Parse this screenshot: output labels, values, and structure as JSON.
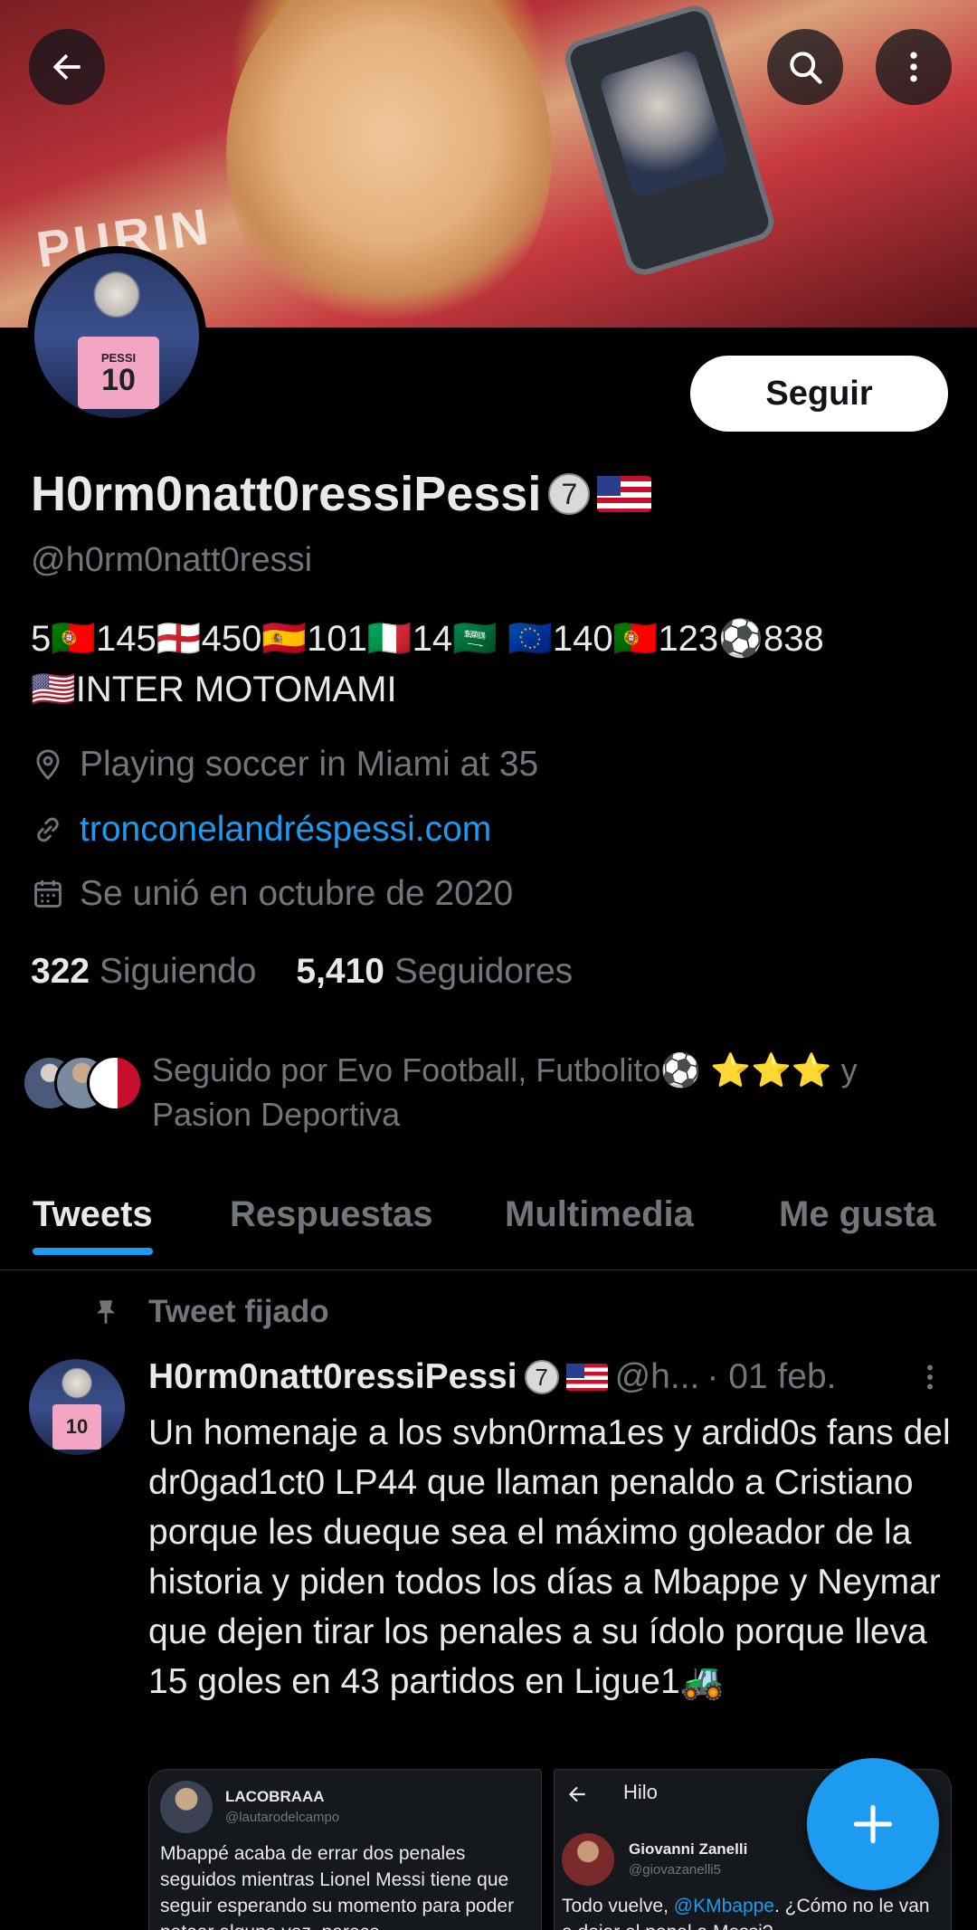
{
  "header": {
    "back_icon": "arrow-left-icon",
    "search_icon": "search-icon",
    "more_icon": "more-vertical-icon",
    "banner_text": "PURIN"
  },
  "profile": {
    "follow_label": "Seguir",
    "display_name": "H0rm0natt0ressiPessi",
    "badge": "7",
    "handle": "@h0rm0natt0ressi",
    "bio_line1": "5🇵🇹145🏴󠁧󠁢󠁥󠁮󠁧󠁿450🇪🇸101🇮🇹14🇸🇦 🇪🇺140🇵🇹123⚽838",
    "bio_line2": "🇺🇸INTER MOTOMAMI",
    "avatar_shirt_name": "PESSI",
    "avatar_shirt_number": "10",
    "location": "Playing soccer in Miami at 35",
    "website": "tronconelandréspessi.com",
    "joined": "Se unió en octubre de 2020",
    "following_count": "322",
    "following_label": "Siguiendo",
    "followers_count": "5,410",
    "followers_label": "Seguidores",
    "followed_by": "Seguido por Evo Football, Futbolito⚽ ⭐⭐⭐ y Pasion Deportiva"
  },
  "tabs": [
    {
      "label": "Tweets",
      "active": true
    },
    {
      "label": "Respuestas",
      "active": false
    },
    {
      "label": "Multimedia",
      "active": false
    },
    {
      "label": "Me gusta",
      "active": false
    }
  ],
  "pinned_tweet": {
    "pinned_label": "Tweet fijado",
    "author_name": "H0rm0natt0ressiPessi",
    "badge": "7",
    "author_handle": "@h...",
    "date": "· 01 feb.",
    "avatar_shirt_number": "10",
    "text": "Un homenaje a los svbn0rma1es y ardid0s fans del dr0gad1ct0 LP44 que llaman penaldo a Cristiano porque les dueque sea el máximo goleador de la historia y piden todos los días a Mbappe y Neymar que dejen tirar los penales a su ídolo porque lleva 15 goles en 43 partidos en Ligue1🚜",
    "media_left": {
      "name": "LACOBRAAA",
      "handle": "@lautarodelcampo",
      "text": "Mbappé acaba de errar dos penales seguidos mientras Lionel Messi tiene que seguir esperando su momento para poder patear alguna vez, parece"
    },
    "media_right": {
      "header": "Hilo",
      "name": "Giovanni Zanelli",
      "handle": "@giovazanelli5",
      "text_pre": "Todo vuelve,",
      "text_mention": "@KMbappe",
      "text_post": ". ¿Cómo no le van a dejar el penal a Messi?"
    }
  },
  "fab": {
    "icon": "plus-icon"
  },
  "colors": {
    "accent": "#1d9bf0",
    "background": "#000000",
    "text_primary": "#e7e9ea",
    "text_secondary": "#71767b"
  }
}
